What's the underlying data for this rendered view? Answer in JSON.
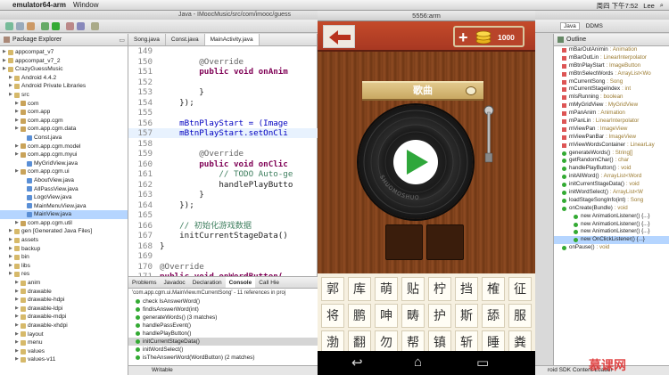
{
  "menubar": {
    "app": "emulator64-arm",
    "menu": "Window",
    "clock": "周四 下午7:52",
    "user": "Lee"
  },
  "eclipse": {
    "title": "Java - IMoocMusic/src/com/imooc/guess",
    "package_explorer": "Package Explorer",
    "tree": [
      {
        "label": "appcompat_v7",
        "indent": 1
      },
      {
        "label": "appcompat_v7_2",
        "indent": 1
      },
      {
        "label": "CrazyGuessMusic",
        "indent": 1
      },
      {
        "label": "Android 4.4.2",
        "indent": 2
      },
      {
        "label": "Android Private Libraries",
        "indent": 2
      },
      {
        "label": "src",
        "indent": 2
      },
      {
        "label": "com",
        "indent": 3
      },
      {
        "label": "com.app",
        "indent": 3
      },
      {
        "label": "com.app.cgm",
        "indent": 3
      },
      {
        "label": "com.app.cgm.data",
        "indent": 3
      },
      {
        "label": "Const.java",
        "indent": 4
      },
      {
        "label": "com.app.cgm.model",
        "indent": 3
      },
      {
        "label": "com.app.cgm.myui",
        "indent": 3
      },
      {
        "label": "MyGridView.java",
        "indent": 4
      },
      {
        "label": "com.app.cgm.ui",
        "indent": 3
      },
      {
        "label": "AboutView.java",
        "indent": 4
      },
      {
        "label": "AllPassView.java",
        "indent": 4
      },
      {
        "label": "LogoView.java",
        "indent": 4
      },
      {
        "label": "MainMenuView.java",
        "indent": 4
      },
      {
        "label": "MainView.java",
        "indent": 4
      },
      {
        "label": "com.app.cgm.util",
        "indent": 3
      },
      {
        "label": "gen [Generated Java Files]",
        "indent": 2
      },
      {
        "label": "assets",
        "indent": 2
      },
      {
        "label": "backup",
        "indent": 2
      },
      {
        "label": "bin",
        "indent": 2
      },
      {
        "label": "libs",
        "indent": 2
      },
      {
        "label": "res",
        "indent": 2
      },
      {
        "label": "anim",
        "indent": 3
      },
      {
        "label": "drawable",
        "indent": 3
      },
      {
        "label": "drawable-hdpi",
        "indent": 3
      },
      {
        "label": "drawable-ldpi",
        "indent": 3
      },
      {
        "label": "drawable-mdpi",
        "indent": 3
      },
      {
        "label": "drawable-xhdpi",
        "indent": 3
      },
      {
        "label": "layout",
        "indent": 3
      },
      {
        "label": "menu",
        "indent": 3
      },
      {
        "label": "values",
        "indent": 3
      },
      {
        "label": "values-v11",
        "indent": 3
      }
    ],
    "editor_tabs": [
      "Song.java",
      "Const.java",
      "MainActivity.java"
    ],
    "code": [
      {
        "n": "149",
        "t": ""
      },
      {
        "n": "150",
        "t": "        @Override"
      },
      {
        "n": "151",
        "t": "        public void onAnim"
      },
      {
        "n": "152",
        "t": ""
      },
      {
        "n": "153",
        "t": "        }"
      },
      {
        "n": "154",
        "t": "    });"
      },
      {
        "n": "155",
        "t": ""
      },
      {
        "n": "156",
        "t": "    mBtnPlayStart = (Image"
      },
      {
        "n": "157",
        "t": "    mBtnPlayStart.setOnCli"
      },
      {
        "n": "158",
        "t": ""
      },
      {
        "n": "159",
        "t": "        @Override"
      },
      {
        "n": "160",
        "t": "        public void onClic"
      },
      {
        "n": "161",
        "t": "            // TODO Auto-ge"
      },
      {
        "n": "162",
        "t": "            handlePlayButto"
      },
      {
        "n": "163",
        "t": "        }"
      },
      {
        "n": "164",
        "t": "    });"
      },
      {
        "n": "165",
        "t": ""
      },
      {
        "n": "166",
        "t": "    // 初始化游戏数据"
      },
      {
        "n": "167",
        "t": "    initCurrentStageData()"
      },
      {
        "n": "168",
        "t": "}"
      },
      {
        "n": "169",
        "t": ""
      },
      {
        "n": "170",
        "t": "@Override"
      },
      {
        "n": "171",
        "t": "public void onWordButton("
      }
    ],
    "bottom_tabs": [
      "Problems",
      "Javadoc",
      "Declaration",
      "Console",
      "Call Hie"
    ],
    "bottom_crumb": "'com.app.cgm.ui.MainView.mCurrentSong' - 11 references in proj",
    "references": [
      "check IsAnswerWord()",
      "findIsAnswerWord(int)",
      "generateWords() (3 matches)",
      "handlePassEvent()",
      "handlePlayButton()",
      "initCurrentStageData()",
      "initWordSelect()",
      "isTheAnswerWord(WordButton) (2 matches)"
    ],
    "status": {
      "writable": "Writable",
      "loader": "roid SDK Content Loader"
    },
    "outline_title": "Outline",
    "outline": [
      {
        "name": "mBarOutAnimin",
        "type": ": Animation"
      },
      {
        "name": "mBarOutLin",
        "type": ": LinearInterpolator"
      },
      {
        "name": "mBtnPlayStart",
        "type": ": ImageButton"
      },
      {
        "name": "mBtnSelectWords",
        "type": ": ArrayList<Wo"
      },
      {
        "name": "mCurrentSong",
        "type": ": Song"
      },
      {
        "name": "mCurrentStageIndex",
        "type": ": int"
      },
      {
        "name": "mIsRunning",
        "type": ": boolean"
      },
      {
        "name": "mMyGridView",
        "type": ": MyGridView"
      },
      {
        "name": "mPanAnim",
        "type": ": Animation"
      },
      {
        "name": "mPanLin",
        "type": ": LinearInterpolator"
      },
      {
        "name": "mViewPan",
        "type": ": ImageView"
      },
      {
        "name": "mViewPanBar",
        "type": ": ImageView"
      },
      {
        "name": "mViewWordsContainer",
        "type": ": LinearLay"
      },
      {
        "name": "generateWords()",
        "type": ": String[]"
      },
      {
        "name": "getRandomChar()",
        "type": ": char"
      },
      {
        "name": "handlePlayButton()",
        "type": ": void"
      },
      {
        "name": "initAllWord()",
        "type": ": ArrayList<Word"
      },
      {
        "name": "initCurrentStageData()",
        "type": ": void"
      },
      {
        "name": "initWordSelect()",
        "type": ": ArrayList<W"
      },
      {
        "name": "loadStageSongInfo(int)",
        "type": ": Song"
      },
      {
        "name": "onCreate(Bundle)",
        "type": ": void"
      },
      {
        "name": "new AnimationListener() {...}",
        "type": ""
      },
      {
        "name": "new AnimationListener() {...}",
        "type": ""
      },
      {
        "name": "new AnimationListener() {...}",
        "type": ""
      },
      {
        "name": "new OnClickListener() {...}",
        "type": ""
      },
      {
        "name": "onPause()",
        "type": ": void"
      }
    ],
    "java_perspective": "Java",
    "ddms": "DDMS"
  },
  "emulator": {
    "title": "5556:arm",
    "coins": "1000",
    "song_label": "歌曲",
    "disc_text": "SHUOMOSHUO",
    "words": [
      "郭",
      "库",
      "萌",
      "贴",
      "柠",
      "挡",
      "榷",
      "征",
      "将",
      "鹏",
      "呻",
      "畴",
      "护",
      "斯",
      "舔",
      "服",
      "渤",
      "翻",
      "勿",
      "帮",
      "镇",
      "斩",
      "睡",
      "粪"
    ]
  },
  "watermark": "慕课网",
  "colors": {
    "accent": "#c44a2a",
    "wood": "#7a3e1a",
    "play": "#2fa73b"
  }
}
